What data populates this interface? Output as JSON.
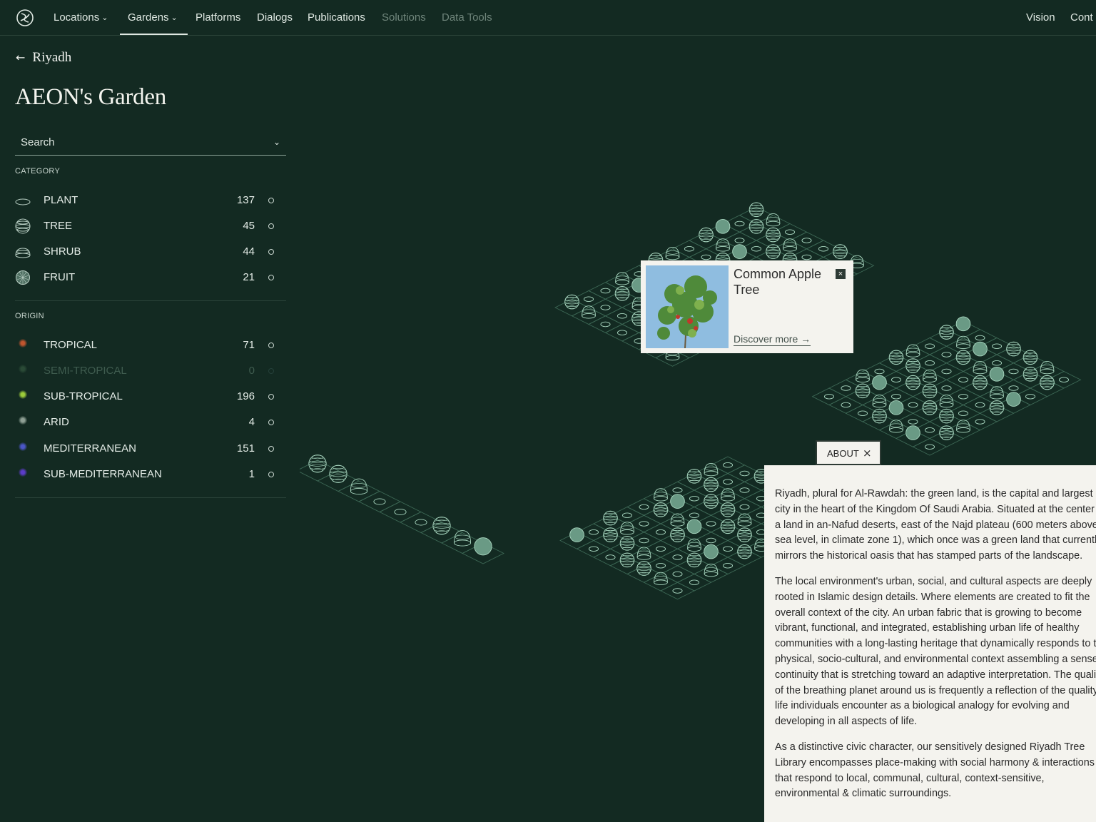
{
  "nav": {
    "items": [
      {
        "label": "Locations",
        "dropdown": true
      },
      {
        "label": "Gardens",
        "dropdown": true,
        "active": true
      },
      {
        "label": "Platforms"
      },
      {
        "label": "Dialogs"
      },
      {
        "label": "Publications"
      },
      {
        "label": "Solutions",
        "dimmed": true
      },
      {
        "label": "Data Tools",
        "dimmed": true
      }
    ],
    "right": [
      "Vision",
      "Cont"
    ]
  },
  "breadcrumb": {
    "back_label": "Riyadh"
  },
  "page_title": "AEON's Garden",
  "search": {
    "label": "Search"
  },
  "category": {
    "heading": "CATEGORY",
    "items": [
      {
        "label": "PLANT",
        "count": "137",
        "icon": "plant-icon"
      },
      {
        "label": "TREE",
        "count": "45",
        "icon": "tree-icon"
      },
      {
        "label": "SHRUB",
        "count": "44",
        "icon": "shrub-icon"
      },
      {
        "label": "FRUIT",
        "count": "21",
        "icon": "fruit-icon"
      }
    ]
  },
  "origin": {
    "heading": "ORIGIN",
    "items": [
      {
        "label": "TROPICAL",
        "count": "71",
        "color": "#c0552e"
      },
      {
        "label": "SEMI-TROPICAL",
        "count": "0",
        "color": "#2a4a36",
        "disabled": true
      },
      {
        "label": "SUB-TROPICAL",
        "count": "196",
        "color": "#9ccb3a"
      },
      {
        "label": "ARID",
        "count": "4",
        "color": "#8fa095"
      },
      {
        "label": "MEDITERRANEAN",
        "count": "151",
        "color": "#4b56c6"
      },
      {
        "label": "SUB-MEDITERRANEAN",
        "count": "1",
        "color": "#5b3cc8"
      }
    ]
  },
  "popup": {
    "name": "Common Apple Tree",
    "link": "Discover more →",
    "close": "×"
  },
  "about": {
    "tab_label": "ABOUT",
    "tab_close": "×",
    "paragraphs": [
      "Riyadh, plural for Al-Rawdah: the green land, is the capital and largest city in the heart of the Kingdom Of Saudi Arabia. Situated at the center of a land in an-Nafud deserts, east of the Najd plateau (600 meters above sea level, in climate zone 1), which once was a green land that currently mirrors the historical oasis that has stamped parts of the landscape.",
      "The local environment's urban, social, and cultural aspects are deeply rooted in Islamic design details. Where elements are created to fit the overall context of the city. An urban fabric that is growing to become vibrant, functional, and integrated, establishing urban life of healthy communities with a long-lasting heritage that dynamically responds to the physical, socio-cultural, and environmental context assembling a sense of continuity that is stretching toward an adaptive interpretation. The quality of the breathing planet around us is frequently a reflection of the quality of life individuals encounter as a biological analogy for evolving and developing in all aspects of life.",
      "As a distinctive civic character, our sensitively designed Riyadh Tree Library encompasses place-making with social harmony & interactions that respond to local, communal, cultural, context-sensitive, environmental & climatic surroundings."
    ]
  },
  "colors": {
    "background": "#132a22",
    "panel": "#f4f3ee",
    "line": "#a9d7c0"
  }
}
